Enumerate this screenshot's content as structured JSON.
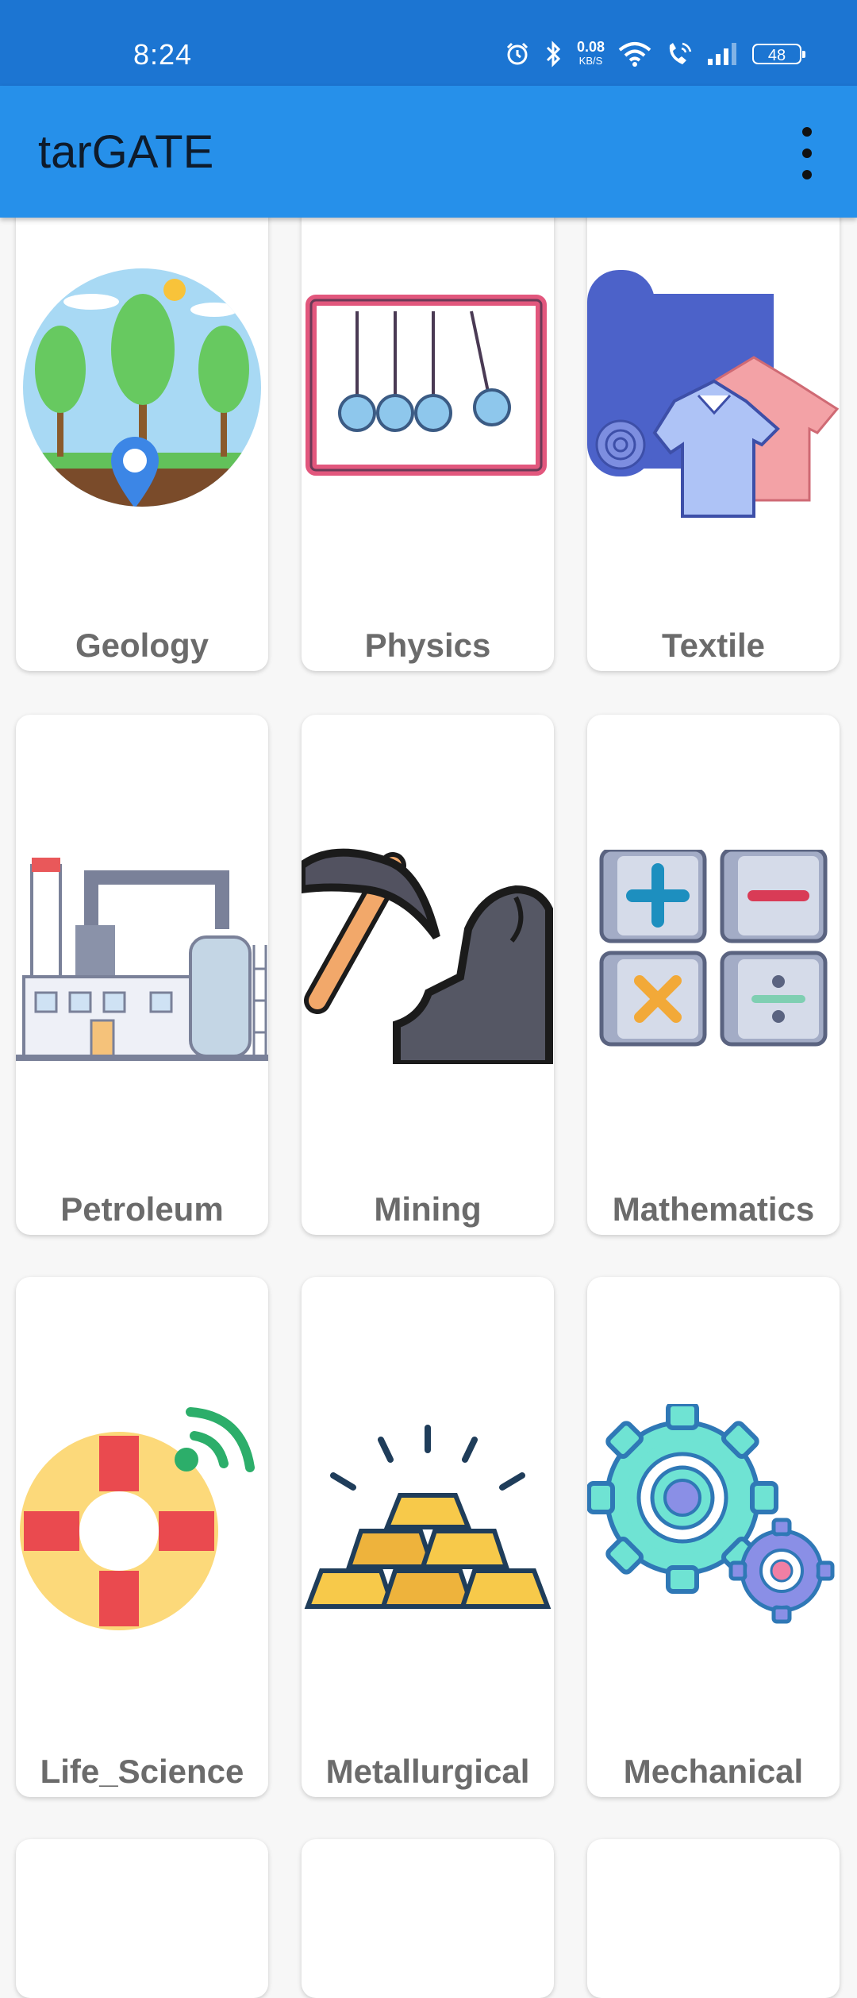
{
  "status_bar": {
    "time": "8:24",
    "net_speed": "0.08",
    "net_unit": "KB/S",
    "battery": "48"
  },
  "app_bar": {
    "title": "tarGATE",
    "menu_icon": "more-vert-icon"
  },
  "subjects": [
    {
      "label": "Geology",
      "icon": "geology-trees-location-icon"
    },
    {
      "label": "Physics",
      "icon": "newtons-cradle-icon"
    },
    {
      "label": "Textile",
      "icon": "fabric-roll-shirt-icon"
    },
    {
      "label": "Petroleum",
      "icon": "refinery-factory-icon"
    },
    {
      "label": "Mining",
      "icon": "pickaxe-rock-icon"
    },
    {
      "label": "Mathematics",
      "icon": "math-operators-icon"
    },
    {
      "label": "Life_Science",
      "icon": "lifebuoy-signal-icon"
    },
    {
      "label": "Metallurgical",
      "icon": "gold-bars-icon"
    },
    {
      "label": "Mechanical",
      "icon": "gears-icon"
    }
  ],
  "colors": {
    "status_bar": "#1c75d2",
    "app_bar": "#2690ea",
    "card_label": "#6b6b6b"
  }
}
